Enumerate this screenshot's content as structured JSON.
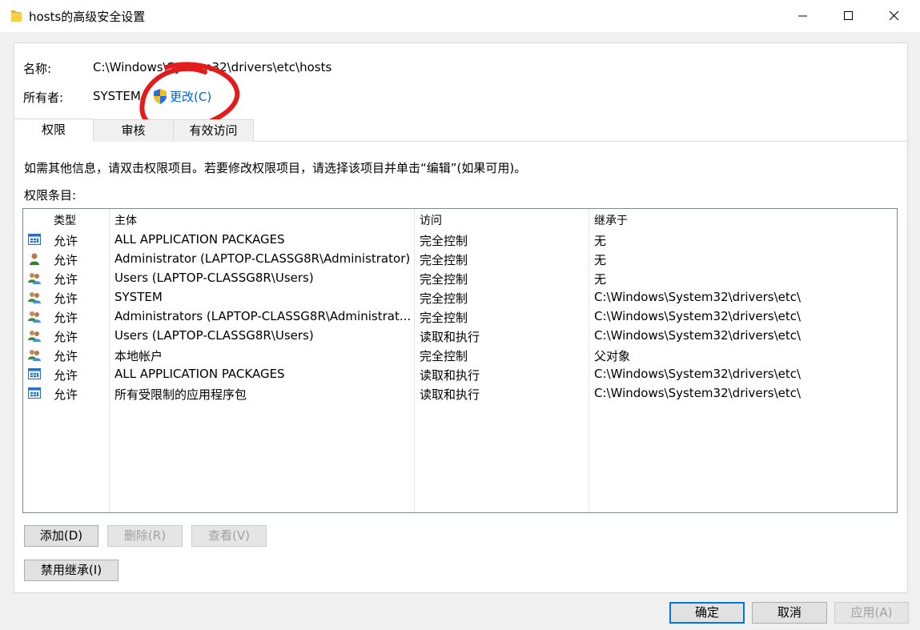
{
  "window": {
    "title": "hosts的高级安全设置",
    "controls": [
      "minimize-icon",
      "maximize-icon",
      "close-icon"
    ]
  },
  "object": {
    "name_label": "名称:",
    "name_value": "C:\\Windows\\System32\\drivers\\etc\\hosts",
    "owner_label": "所有者:",
    "owner_value": "SYSTEM",
    "change_label": "更改(C)",
    "change_icon": "uac-shield-icon"
  },
  "annotation": {
    "color": "#e31b1b",
    "shape": "hand-drawn-circle"
  },
  "tabs": [
    {
      "label": "权限",
      "active": true
    },
    {
      "label": "审核",
      "active": false
    },
    {
      "label": "有效访问",
      "active": false
    }
  ],
  "info_text": "如需其他信息，请双击权限项目。若要修改权限项目，请选择该项目并单击“编辑”(如果可用)。",
  "entries_label": "权限条目:",
  "table": {
    "columns": [
      "类型",
      "主体",
      "访问",
      "继承于"
    ],
    "rows": [
      {
        "icon": "app-package-icon",
        "type": "允许",
        "principal": "ALL APPLICATION PACKAGES",
        "access": "完全控制",
        "inherited": "无"
      },
      {
        "icon": "user-icon",
        "type": "允许",
        "principal": "Administrator (LAPTOP-CLASSG8R\\Administrator)",
        "access": "完全控制",
        "inherited": "无"
      },
      {
        "icon": "group-icon",
        "type": "允许",
        "principal": "Users (LAPTOP-CLASSG8R\\Users)",
        "access": "完全控制",
        "inherited": "无"
      },
      {
        "icon": "group-icon",
        "type": "允许",
        "principal": "SYSTEM",
        "access": "完全控制",
        "inherited": "C:\\Windows\\System32\\drivers\\etc\\"
      },
      {
        "icon": "group-icon",
        "type": "允许",
        "principal": "Administrators (LAPTOP-CLASSG8R\\Administrat...",
        "access": "完全控制",
        "inherited": "C:\\Windows\\System32\\drivers\\etc\\"
      },
      {
        "icon": "group-icon",
        "type": "允许",
        "principal": "Users (LAPTOP-CLASSG8R\\Users)",
        "access": "读取和执行",
        "inherited": "C:\\Windows\\System32\\drivers\\etc\\"
      },
      {
        "icon": "group-icon",
        "type": "允许",
        "principal": "本地帐户",
        "access": "完全控制",
        "inherited": "父对象"
      },
      {
        "icon": "app-package-icon",
        "type": "允许",
        "principal": "ALL APPLICATION PACKAGES",
        "access": "读取和执行",
        "inherited": "C:\\Windows\\System32\\drivers\\etc\\"
      },
      {
        "icon": "app-package-icon",
        "type": "允许",
        "principal": "所有受限制的应用程序包",
        "access": "读取和执行",
        "inherited": "C:\\Windows\\System32\\drivers\\etc\\"
      }
    ]
  },
  "buttons": {
    "add": "添加(D)",
    "remove": "删除(R)",
    "view": "查看(V)",
    "disable_inheritance": "禁用继承(I)",
    "ok": "确定",
    "cancel": "取消",
    "apply": "应用(A)"
  }
}
